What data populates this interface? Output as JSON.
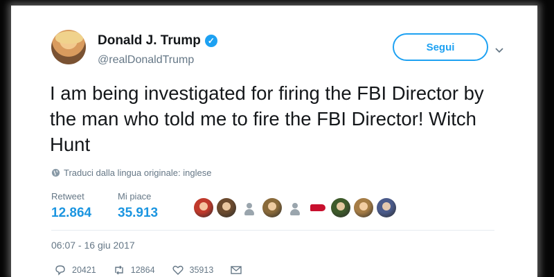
{
  "tweet": {
    "author_name": "Donald J. Trump",
    "author_handle": "@realDonaldTrump",
    "follow_label": "Segui",
    "text": "I am being investigated for firing the FBI Director by the man who told me to fire the FBI Director! Witch Hunt",
    "translate_label": "Traduci dalla lingua originale: inglese",
    "timestamp": "06:07 - 16 giu 2017"
  },
  "stats": {
    "retweet_label": "Retweet",
    "retweet_value": "12.864",
    "like_label": "Mi piace",
    "like_value": "35.913"
  },
  "actions": {
    "reply_count": "20421",
    "retweet_count": "12864",
    "like_count": "35913"
  },
  "likers": [
    {
      "type": "photo",
      "color": "#c0392b"
    },
    {
      "type": "photo",
      "color": "#6b4a2e"
    },
    {
      "type": "default",
      "color": "#9aa5ad"
    },
    {
      "type": "photo",
      "color": "#8a6a3a"
    },
    {
      "type": "default",
      "color": "#9aa5ad"
    },
    {
      "type": "map",
      "color": "#c8102e"
    },
    {
      "type": "photo",
      "color": "#3d5a2a"
    },
    {
      "type": "photo",
      "color": "#a57c45"
    },
    {
      "type": "photo",
      "color": "#4a5a8a"
    }
  ],
  "colors": {
    "accent": "#1da1f2",
    "stat_value": "#1b95e0",
    "text": "#14171a",
    "muted": "#657786"
  },
  "icons": {
    "verified": "verified-badge-icon",
    "chevron": "chevron-down-icon",
    "globe": "globe-icon",
    "reply": "reply-icon",
    "retweet": "retweet-icon",
    "like": "heart-icon",
    "message": "envelope-icon"
  }
}
